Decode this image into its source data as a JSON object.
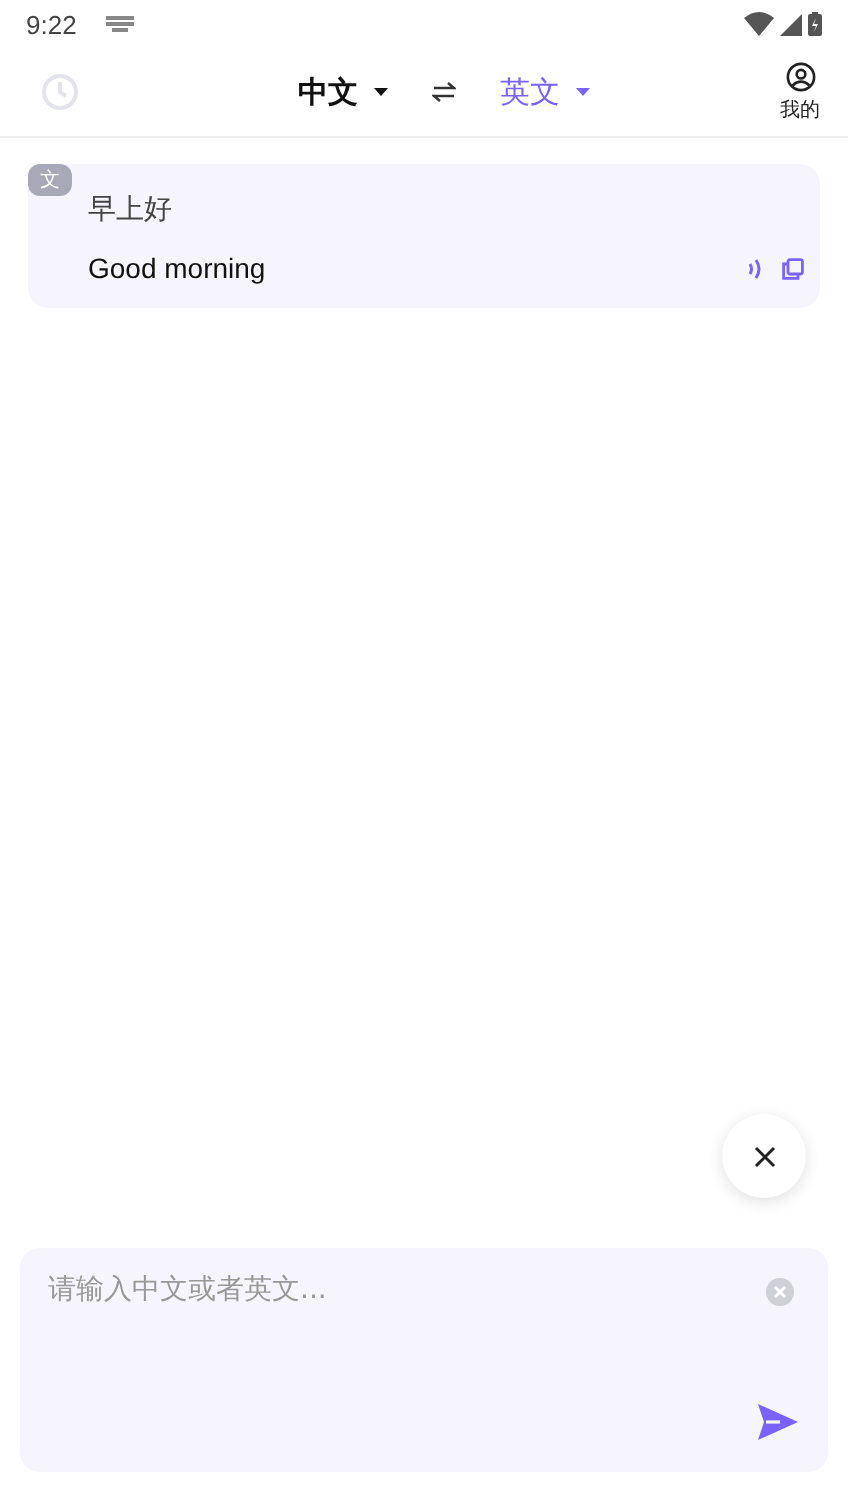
{
  "status_bar": {
    "time": "9:22"
  },
  "header": {
    "languages": [
      {
        "label": "中文",
        "selected": false
      },
      {
        "label": "英文",
        "selected": true
      }
    ],
    "profile_label": "我的"
  },
  "history": [
    {
      "badge": "文",
      "source": "早上好",
      "translation": "Good morning"
    }
  ],
  "input": {
    "placeholder": "请输入中文或者英文..."
  }
}
